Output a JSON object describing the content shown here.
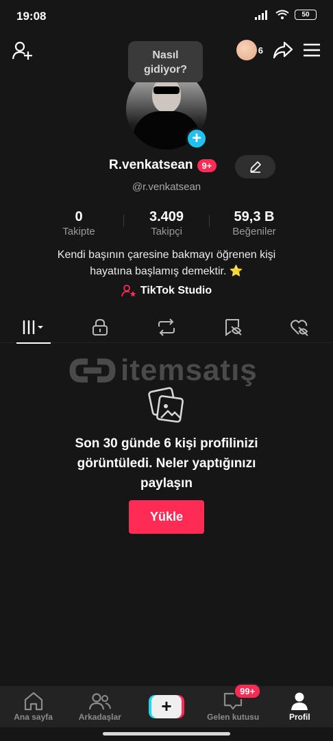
{
  "status_bar": {
    "time": "19:08",
    "battery": "50"
  },
  "header": {
    "viewer_count": "6",
    "bubble_line1": "Nasıl",
    "bubble_line2": "gidiyor?"
  },
  "profile": {
    "username": "R.venkatsean",
    "notification_badge": "9+",
    "handle": "@r.venkatsean",
    "stats": [
      {
        "value": "0",
        "label": "Takipte"
      },
      {
        "value": "3.409",
        "label": "Takipçi"
      },
      {
        "value": "59,3 B",
        "label": "Beğeniler"
      }
    ],
    "bio_line1": "Kendi başının çaresine bakmayı öğrenen kişi",
    "bio_line2": "hayatına başlamış demektir. ⭐",
    "studio_link": "TikTok Studio"
  },
  "tabs": [
    {
      "icon": "grid-icon",
      "active": true
    },
    {
      "icon": "lock-icon"
    },
    {
      "icon": "repost-icon"
    },
    {
      "icon": "favorites-icon"
    },
    {
      "icon": "liked-icon"
    }
  ],
  "watermark": "itemsatış",
  "empty_state": {
    "line1": "Son 30 günde 6 kişi profilinizi",
    "line2": "görüntüledi. Neler yaptığınızı",
    "line3": "paylaşın",
    "button": "Yükle"
  },
  "nav": {
    "home": "Ana sayfa",
    "friends": "Arkadaşlar",
    "create": "+",
    "inbox": "Gelen kutusu",
    "inbox_badge": "99+",
    "profile": "Profil"
  },
  "colors": {
    "accent": "#fe2c55",
    "cyan": "#20d5ec",
    "background": "#161616"
  }
}
